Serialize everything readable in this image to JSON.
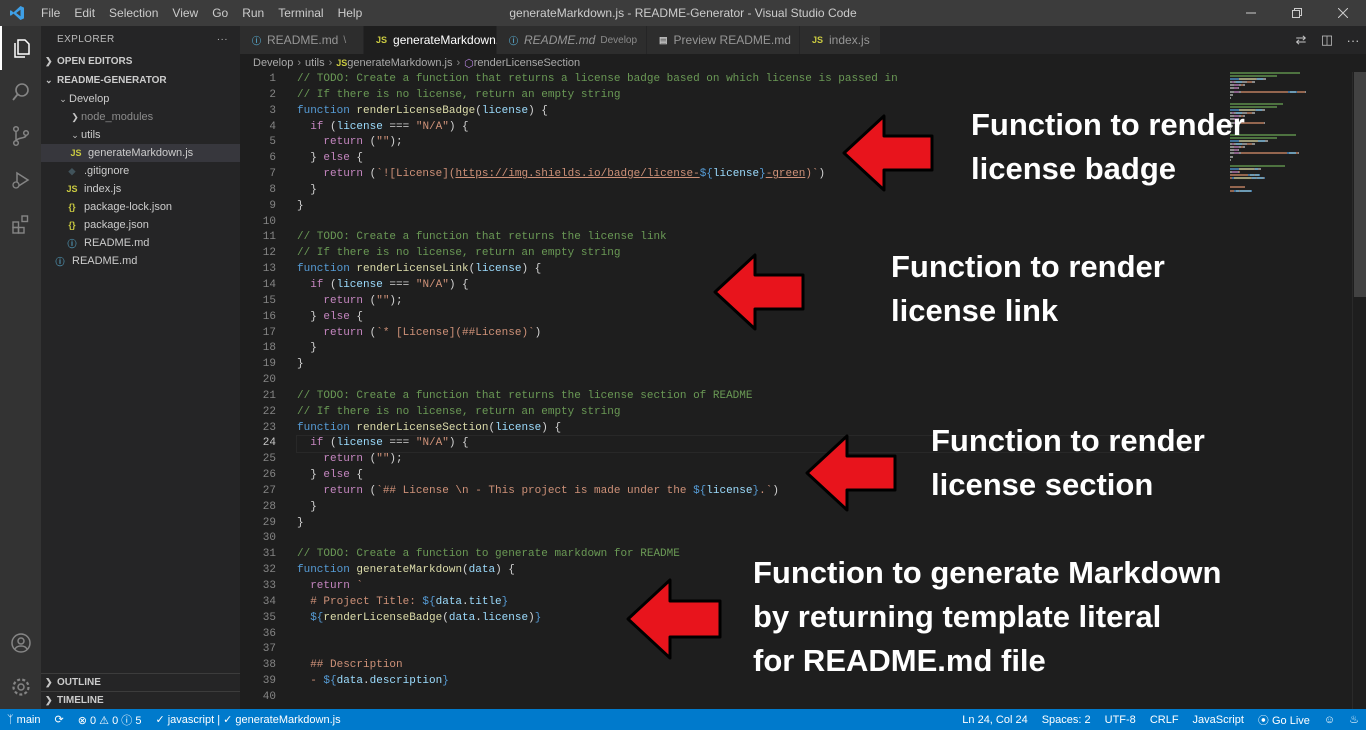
{
  "titlebar": {
    "menu": [
      "File",
      "Edit",
      "Selection",
      "View",
      "Go",
      "Run",
      "Terminal",
      "Help"
    ],
    "title": "generateMarkdown.js - README-Generator - Visual Studio Code"
  },
  "sidebar": {
    "header": "EXPLORER",
    "more": "···",
    "open_editors": "OPEN EDITORS",
    "project": "README-GENERATOR",
    "items": [
      {
        "label": "Develop",
        "icon": "chevron-down",
        "type": "folder"
      },
      {
        "label": "node_modules",
        "icon": "chevron-right",
        "type": "folder"
      },
      {
        "label": "utils",
        "icon": "chevron-down",
        "type": "folder"
      },
      {
        "label": "generateMarkdown.js",
        "icon": "JS",
        "type": "file"
      },
      {
        "label": ".gitignore",
        "icon": "git",
        "type": "file"
      },
      {
        "label": "index.js",
        "icon": "JS",
        "type": "file"
      },
      {
        "label": "package-lock.json",
        "icon": "{}",
        "type": "file"
      },
      {
        "label": "package.json",
        "icon": "{}",
        "type": "file"
      },
      {
        "label": "README.md",
        "icon": "info",
        "type": "file"
      },
      {
        "label": "README.md",
        "icon": "info",
        "type": "file"
      }
    ],
    "outline": "OUTLINE",
    "timeline": "TIMELINE"
  },
  "tabs": [
    {
      "label": "README.md",
      "desc": "\\",
      "icon": "info"
    },
    {
      "label": "generateMarkdown.js",
      "icon": "JS",
      "close": "✕"
    },
    {
      "label": "README.md",
      "desc": "Develop",
      "icon": "info"
    },
    {
      "label": "Preview README.md",
      "icon": "preview"
    },
    {
      "label": "index.js",
      "icon": "JS"
    }
  ],
  "breadcrumb": [
    "Develop",
    "utils",
    "generateMarkdown.js",
    "renderLicenseSection"
  ],
  "editor": {
    "line_numbers": [
      "1",
      "2",
      "3",
      "4",
      "5",
      "6",
      "7",
      "8",
      "9",
      "10",
      "11",
      "12",
      "13",
      "14",
      "15",
      "16",
      "17",
      "18",
      "19",
      "20",
      "21",
      "22",
      "23",
      "24",
      "25",
      "26",
      "27",
      "28",
      "29",
      "30",
      "31",
      "32",
      "33",
      "34",
      "35",
      "36",
      "37",
      "38",
      "39",
      "40"
    ],
    "current_line": "24",
    "lines": [
      [
        [
          "c",
          "// TODO: Create a function that returns a license badge based on which license is passed in"
        ]
      ],
      [
        [
          "c",
          "// If there is no license, return an empty string"
        ]
      ],
      [
        [
          "k",
          "function "
        ],
        [
          "f",
          "renderLicenseBadge"
        ],
        [
          "o",
          "("
        ],
        [
          "v",
          "license"
        ],
        [
          "o",
          ") {"
        ]
      ],
      [
        [
          "o",
          "  "
        ],
        [
          "x",
          "if"
        ],
        [
          "o",
          " ("
        ],
        [
          "v",
          "license"
        ],
        [
          "o",
          " === "
        ],
        [
          "s",
          "\"N/A\""
        ],
        [
          "o",
          ") {"
        ]
      ],
      [
        [
          "o",
          "    "
        ],
        [
          "x",
          "return"
        ],
        [
          "o",
          " ("
        ],
        [
          "s",
          "\"\""
        ],
        [
          "o",
          ");"
        ]
      ],
      [
        [
          "o",
          "  } "
        ],
        [
          "x",
          "else"
        ],
        [
          "o",
          " {"
        ]
      ],
      [
        [
          "o",
          "    "
        ],
        [
          "x",
          "return"
        ],
        [
          "o",
          " ("
        ],
        [
          "s",
          "`![License]("
        ],
        [
          "u",
          "https://img.shields.io/badge/license-"
        ],
        [
          "k",
          "${"
        ],
        [
          "v",
          "license"
        ],
        [
          "k",
          "}"
        ],
        [
          "u",
          "-green"
        ],
        [
          "s",
          ")`"
        ],
        [
          "o",
          ")"
        ]
      ],
      [
        [
          "o",
          "  }"
        ]
      ],
      [
        [
          "o",
          "}"
        ]
      ],
      [],
      [
        [
          "c",
          "// TODO: Create a function that returns the license link"
        ]
      ],
      [
        [
          "c",
          "// If there is no license, return an empty string"
        ]
      ],
      [
        [
          "k",
          "function "
        ],
        [
          "f",
          "renderLicenseLink"
        ],
        [
          "o",
          "("
        ],
        [
          "v",
          "license"
        ],
        [
          "o",
          ") {"
        ]
      ],
      [
        [
          "o",
          "  "
        ],
        [
          "x",
          "if"
        ],
        [
          "o",
          " ("
        ],
        [
          "v",
          "license"
        ],
        [
          "o",
          " === "
        ],
        [
          "s",
          "\"N/A\""
        ],
        [
          "o",
          ") {"
        ]
      ],
      [
        [
          "o",
          "    "
        ],
        [
          "x",
          "return"
        ],
        [
          "o",
          " ("
        ],
        [
          "s",
          "\"\""
        ],
        [
          "o",
          ");"
        ]
      ],
      [
        [
          "o",
          "  } "
        ],
        [
          "x",
          "else"
        ],
        [
          "o",
          " {"
        ]
      ],
      [
        [
          "o",
          "    "
        ],
        [
          "x",
          "return"
        ],
        [
          "o",
          " ("
        ],
        [
          "s",
          "`* [License](##License)`"
        ],
        [
          "o",
          ")"
        ]
      ],
      [
        [
          "o",
          "  }"
        ]
      ],
      [
        [
          "o",
          "}"
        ]
      ],
      [],
      [
        [
          "c",
          "// TODO: Create a function that returns the license section of README"
        ]
      ],
      [
        [
          "c",
          "// If there is no license, return an empty string"
        ]
      ],
      [
        [
          "k",
          "function "
        ],
        [
          "f",
          "renderLicenseSection"
        ],
        [
          "o",
          "("
        ],
        [
          "v",
          "license"
        ],
        [
          "o",
          ") {"
        ]
      ],
      [
        [
          "o",
          "  "
        ],
        [
          "x",
          "if"
        ],
        [
          "o",
          " ("
        ],
        [
          "v",
          "license"
        ],
        [
          "o",
          " === "
        ],
        [
          "s",
          "\"N/A\""
        ],
        [
          "o",
          ") {"
        ]
      ],
      [
        [
          "o",
          "    "
        ],
        [
          "x",
          "return"
        ],
        [
          "o",
          " ("
        ],
        [
          "s",
          "\"\""
        ],
        [
          "o",
          ");"
        ]
      ],
      [
        [
          "o",
          "  } "
        ],
        [
          "x",
          "else"
        ],
        [
          "o",
          " {"
        ]
      ],
      [
        [
          "o",
          "    "
        ],
        [
          "x",
          "return"
        ],
        [
          "o",
          " ("
        ],
        [
          "s",
          "`## License \\n - This project is made under the "
        ],
        [
          "k",
          "${"
        ],
        [
          "v",
          "license"
        ],
        [
          "k",
          "}"
        ],
        [
          "s",
          ".`"
        ],
        [
          "o",
          ")"
        ]
      ],
      [
        [
          "o",
          "  }"
        ]
      ],
      [
        [
          "o",
          "}"
        ]
      ],
      [],
      [
        [
          "c",
          "// TODO: Create a function to generate markdown for README"
        ]
      ],
      [
        [
          "k",
          "function "
        ],
        [
          "f",
          "generateMarkdown"
        ],
        [
          "o",
          "("
        ],
        [
          "v",
          "data"
        ],
        [
          "o",
          ") {"
        ]
      ],
      [
        [
          "o",
          "  "
        ],
        [
          "x",
          "return"
        ],
        [
          "o",
          " "
        ],
        [
          "s",
          "`"
        ]
      ],
      [
        [
          "s",
          "  # Project Title: "
        ],
        [
          "k",
          "${"
        ],
        [
          "v",
          "data"
        ],
        [
          "o",
          "."
        ],
        [
          "v",
          "title"
        ],
        [
          "k",
          "}"
        ]
      ],
      [
        [
          "s",
          "  "
        ],
        [
          "k",
          "${"
        ],
        [
          "f",
          "renderLicenseBadge"
        ],
        [
          "o",
          "("
        ],
        [
          "v",
          "data"
        ],
        [
          "o",
          "."
        ],
        [
          "v",
          "license"
        ],
        [
          "o",
          ")"
        ],
        [
          "k",
          "}"
        ]
      ],
      [],
      [],
      [
        [
          "s",
          "  ## Description"
        ]
      ],
      [
        [
          "s",
          "  - "
        ],
        [
          "k",
          "${"
        ],
        [
          "v",
          "data"
        ],
        [
          "o",
          "."
        ],
        [
          "v",
          "description"
        ],
        [
          "k",
          "}"
        ]
      ],
      []
    ]
  },
  "annotations": [
    {
      "line1": "Function to render",
      "line2": "license badge",
      "line3": ""
    },
    {
      "line1": "Function to render",
      "line2": "license link",
      "line3": ""
    },
    {
      "line1": "Function to render",
      "line2": "license section",
      "line3": ""
    },
    {
      "line1": "Function to generate Markdown",
      "line2": "by returning template literal",
      "line3": "for README.md file"
    }
  ],
  "statusbar": {
    "branch": "main",
    "problems": "⊗ 0 ⚠ 0 ⓘ 5",
    "lang_check": "✓ javascript | ✓ generateMarkdown.js",
    "position": "Ln 24, Col 24",
    "spaces": "Spaces: 2",
    "encoding": "UTF-8",
    "eol": "CRLF",
    "language": "JavaScript",
    "golive": "Go Live"
  },
  "colors": {
    "accent": "#007acc",
    "arrow_red": "#e8141c",
    "editor_bg": "#1e1e1e"
  }
}
